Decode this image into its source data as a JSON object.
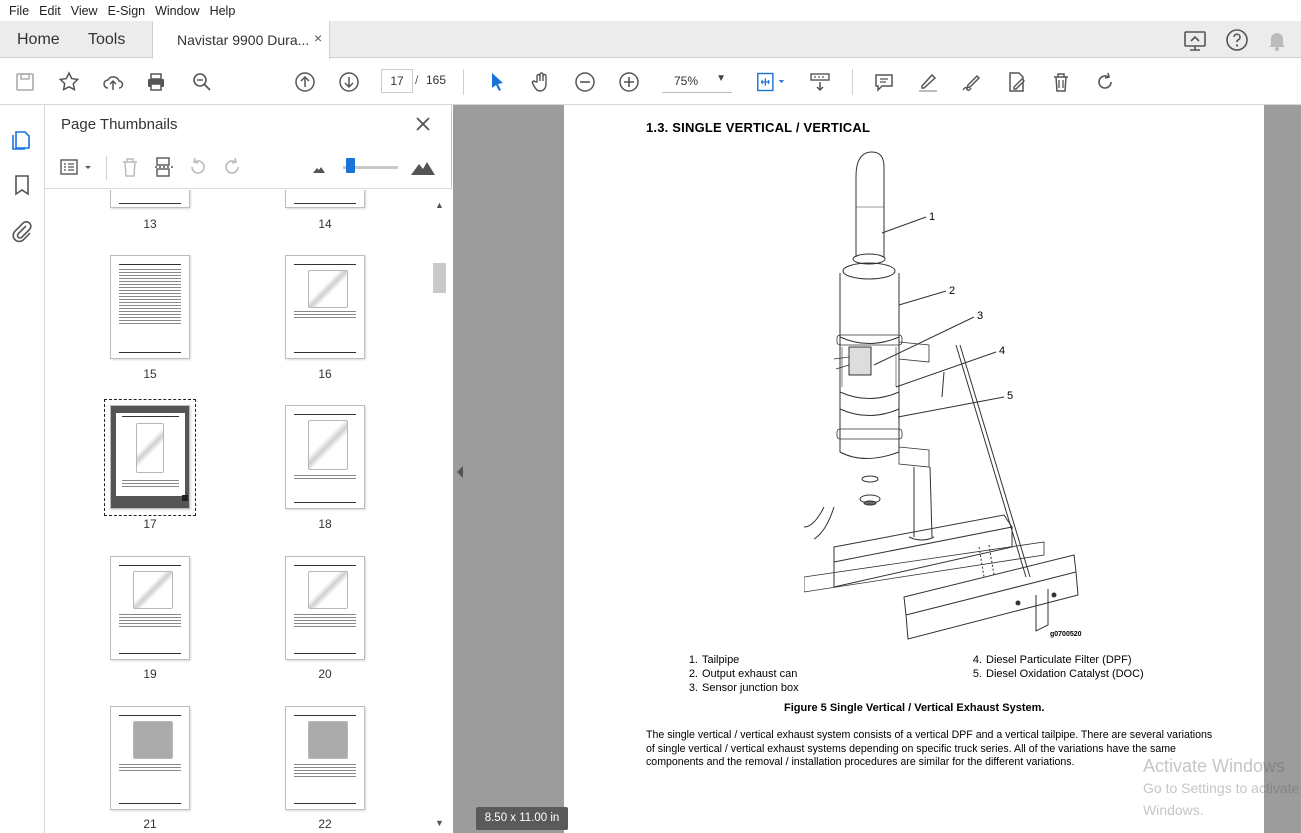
{
  "menu": [
    "File",
    "Edit",
    "View",
    "E-Sign",
    "Window",
    "Help"
  ],
  "tabs": {
    "home": "Home",
    "tools": "Tools",
    "document": "Navistar 9900 Dura...",
    "close": "×"
  },
  "toolbar": {
    "current_page": "17",
    "separator": "/",
    "total_pages": "165",
    "zoom": "75%"
  },
  "panel": {
    "title": "Page Thumbnails",
    "page_labels": [
      "13",
      "14",
      "15",
      "16",
      "17",
      "18",
      "19",
      "20",
      "21",
      "22"
    ],
    "selected_page": "17"
  },
  "document": {
    "heading": "1.3.  SINGLE VERTICAL / VERTICAL",
    "callouts": [
      "1",
      "2",
      "3",
      "4",
      "5"
    ],
    "figure_id": "g0700520",
    "legend_left": [
      {
        "n": "1.",
        "t": "Tailpipe"
      },
      {
        "n": "2.",
        "t": "Output exhaust can"
      },
      {
        "n": "3.",
        "t": "Sensor junction box"
      }
    ],
    "legend_right": [
      {
        "n": "4.",
        "t": "Diesel Particulate Filter (DPF)"
      },
      {
        "n": "5.",
        "t": "Diesel Oxidation Catalyst (DOC)"
      }
    ],
    "caption": "Figure 5   Single Vertical / Vertical Exhaust System.",
    "paragraph": "The single vertical / vertical exhaust system consists of a vertical DPF and a vertical tailpipe.  There are several variations of single vertical / vertical exhaust systems depending on specific truck series.  All of the variations have the same components and the removal / installation procedures are similar for the different variations."
  },
  "page_size": "8.50 x 11.00 in",
  "watermark": {
    "line1": "Activate Windows",
    "line2": "Go to Settings to activate Windows."
  },
  "colors": {
    "accent": "#1a73d9",
    "viewer_bg": "#9c9c9c"
  }
}
